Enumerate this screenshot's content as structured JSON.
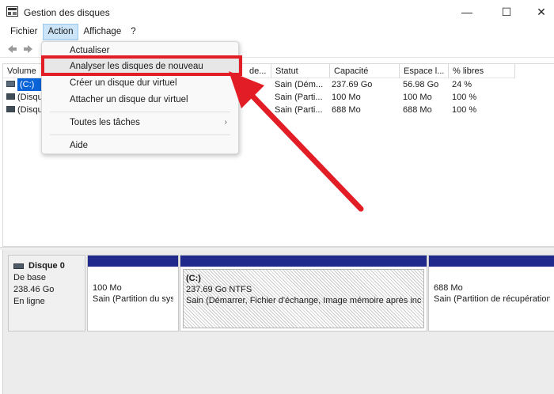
{
  "window": {
    "title": "Gestion des disques",
    "icon": "disk-management-icon"
  },
  "controls": {
    "minimize": "—",
    "maximize": "☐",
    "close": "✕"
  },
  "menubar": {
    "items": [
      {
        "label": "Fichier"
      },
      {
        "label": "Action",
        "active": true
      },
      {
        "label": "Affichage"
      },
      {
        "label": "?"
      }
    ]
  },
  "toolbar": {
    "back_icon": "arrow-left-icon",
    "forward_icon": "arrow-right-icon"
  },
  "volumes": {
    "columns": [
      "Volume",
      "de...",
      "Statut",
      "Capacité",
      "Espace l...",
      "% libres"
    ],
    "rows": [
      {
        "volume": "(C:)",
        "status": "Sain (Dém...",
        "capacity": "237.69 Go",
        "free": "56.98 Go",
        "pct": "24 %"
      },
      {
        "volume": "(Disqu",
        "status": "Sain (Parti...",
        "capacity": "100 Mo",
        "free": "100 Mo",
        "pct": "100 %"
      },
      {
        "volume": "(Disqu",
        "status": "Sain (Parti...",
        "capacity": "688 Mo",
        "free": "688 Mo",
        "pct": "100 %"
      }
    ]
  },
  "disk0": {
    "name": "Disque 0",
    "type": "De base",
    "size": "238.46 Go",
    "state": "En ligne",
    "partitions": [
      {
        "label": "",
        "size": "100 Mo",
        "status": "Sain (Partition du sys"
      },
      {
        "label": "(C:)",
        "size": "237.69 Go NTFS",
        "status": "Sain (Démarrer, Fichier d'échange, Image mémoire après inc"
      },
      {
        "label": "",
        "size": "688 Mo",
        "status": "Sain (Partition de récupération"
      }
    ]
  },
  "action_menu": {
    "items": {
      "refresh": "Actualiser",
      "rescan": "Analyser les disques de nouveau",
      "create_vhd": "Créer un disque dur virtuel",
      "attach_vhd": "Attacher un disque dur virtuel",
      "all_tasks": "Toutes les tâches",
      "help": "Aide"
    },
    "submenu_arrow": "›"
  },
  "annotation": {
    "color": "#e21d25"
  }
}
